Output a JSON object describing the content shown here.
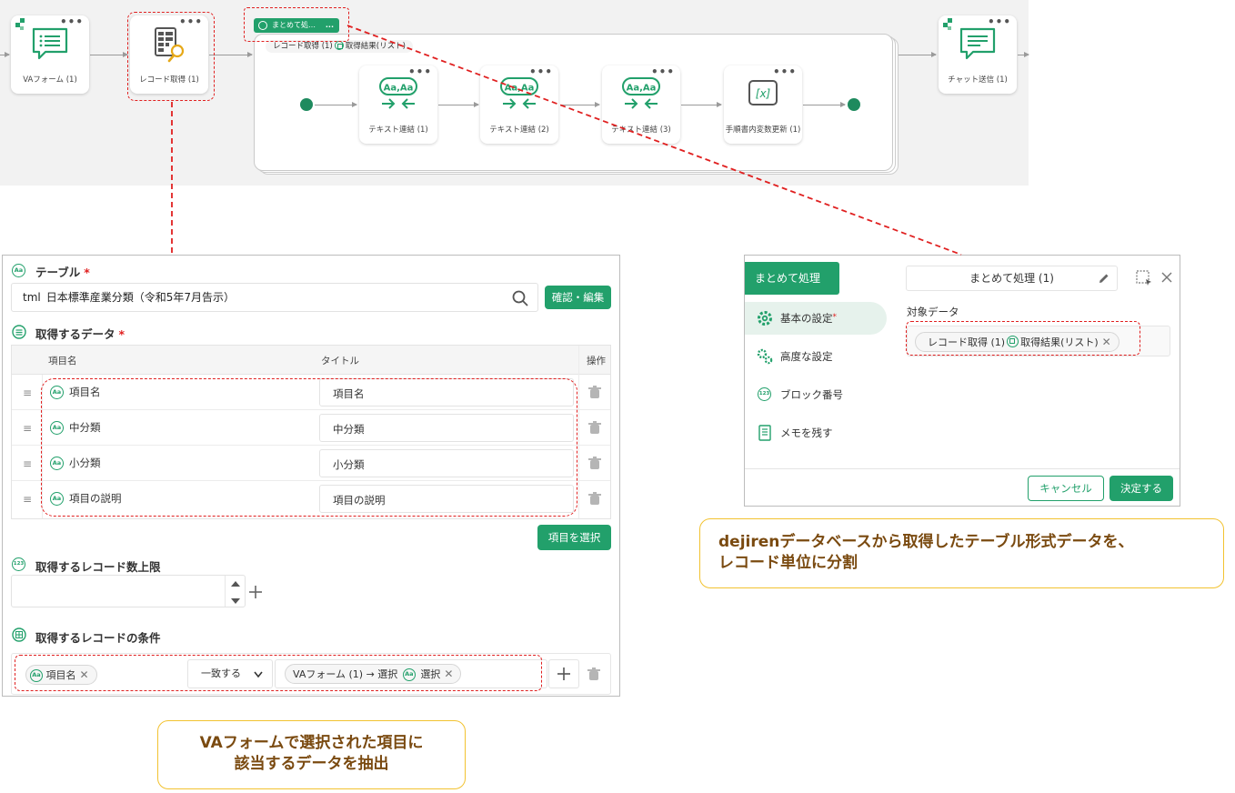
{
  "flow": {
    "nodes": {
      "va_form": "VAフォーム (1)",
      "record_get": "レコード取得 (1)",
      "text_concat_1": "テキスト連結 (1)",
      "text_concat_2": "テキスト連結 (2)",
      "text_concat_3": "テキスト連結 (3)",
      "var_update": "手順書内変数更新 (1)",
      "chat_send": "チャット送信 (1)"
    },
    "aa_icon_text": "Aa,Aa",
    "var_icon_text": "[x]",
    "group_tag": "まとめて処…",
    "group_target_source": "レコード取得 (1)",
    "group_target_field": "取得結果(リスト)",
    "more_dots": "•••"
  },
  "left": {
    "aa": "Aa",
    "table_label": "テーブル",
    "required_mark": "*",
    "table_value": "tml_日本標準産業分類（令和5年7月告示）",
    "confirm_edit": "確認・編集",
    "data_label": "取得するデータ",
    "col_item": "項目名",
    "col_title": "タイトル",
    "col_op": "操作",
    "rows": [
      {
        "item": "項目名",
        "title": "項目名"
      },
      {
        "item": "中分類",
        "title": "中分類"
      },
      {
        "item": "小分類",
        "title": "小分類"
      },
      {
        "item": "項目の説明",
        "title": "項目の説明"
      }
    ],
    "select_items": "項目を選択",
    "limit_label": "取得するレコード数上限",
    "limit_icon_text": "123",
    "cond_label": "取得するレコードの条件",
    "cond_field": "項目名",
    "cond_op": "一致する",
    "cond_value_source": "VAフォーム (1) → 選択",
    "cond_value_field": "選択"
  },
  "right": {
    "tab": "まとめて処理",
    "menu": {
      "basic": "基本の設定",
      "advanced": "高度な設定",
      "block_no": "ブロック番号",
      "memo": "メモを残す"
    },
    "required_mark": "*",
    "block_icon_text": "123",
    "name_value": "まとめて処理 (1)",
    "target_label": "対象データ",
    "target_source": "レコード取得 (1)",
    "target_field": "取得結果(リスト)",
    "cancel": "キャンセル",
    "decide": "決定する"
  },
  "callouts": {
    "right_1": "dejirenデータベースから取得したテーブル形式データを、",
    "right_2": "レコード単位に分割",
    "left_1": "VAフォームで選択された項目に",
    "left_2": "該当するデータを抽出"
  },
  "colors": {
    "accent": "#22a06b",
    "annotation": "#e02020",
    "callout_border": "#f2c230",
    "callout_text": "#7a4a10"
  }
}
